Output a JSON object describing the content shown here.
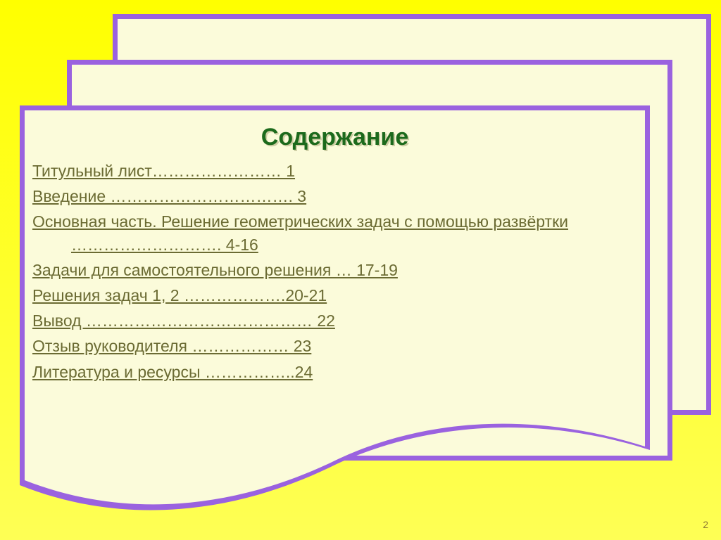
{
  "title": "Содержание",
  "toc": [
    {
      "text": "Титульный лист…………………… 1",
      "wrap": false
    },
    {
      "text": "Введение ……………………………. 3",
      "wrap": false
    },
    {
      "text": "Основная часть. Решение геометрических задач с помощью развёртки ………………………. 4-16",
      "wrap": true
    },
    {
      "text": "Задачи для самостоятельного решения … 17-19",
      "wrap": false
    },
    {
      "text": "Решения задач 1, 2 ……………….20-21",
      "wrap": false
    },
    {
      "text": "Вывод …………………………………… 22",
      "wrap": false
    },
    {
      "text": "Отзыв руководителя ……………… 23",
      "wrap": false
    },
    {
      "text": "Литература и ресурсы ……………..24",
      "wrap": false
    }
  ],
  "page_number": "2"
}
